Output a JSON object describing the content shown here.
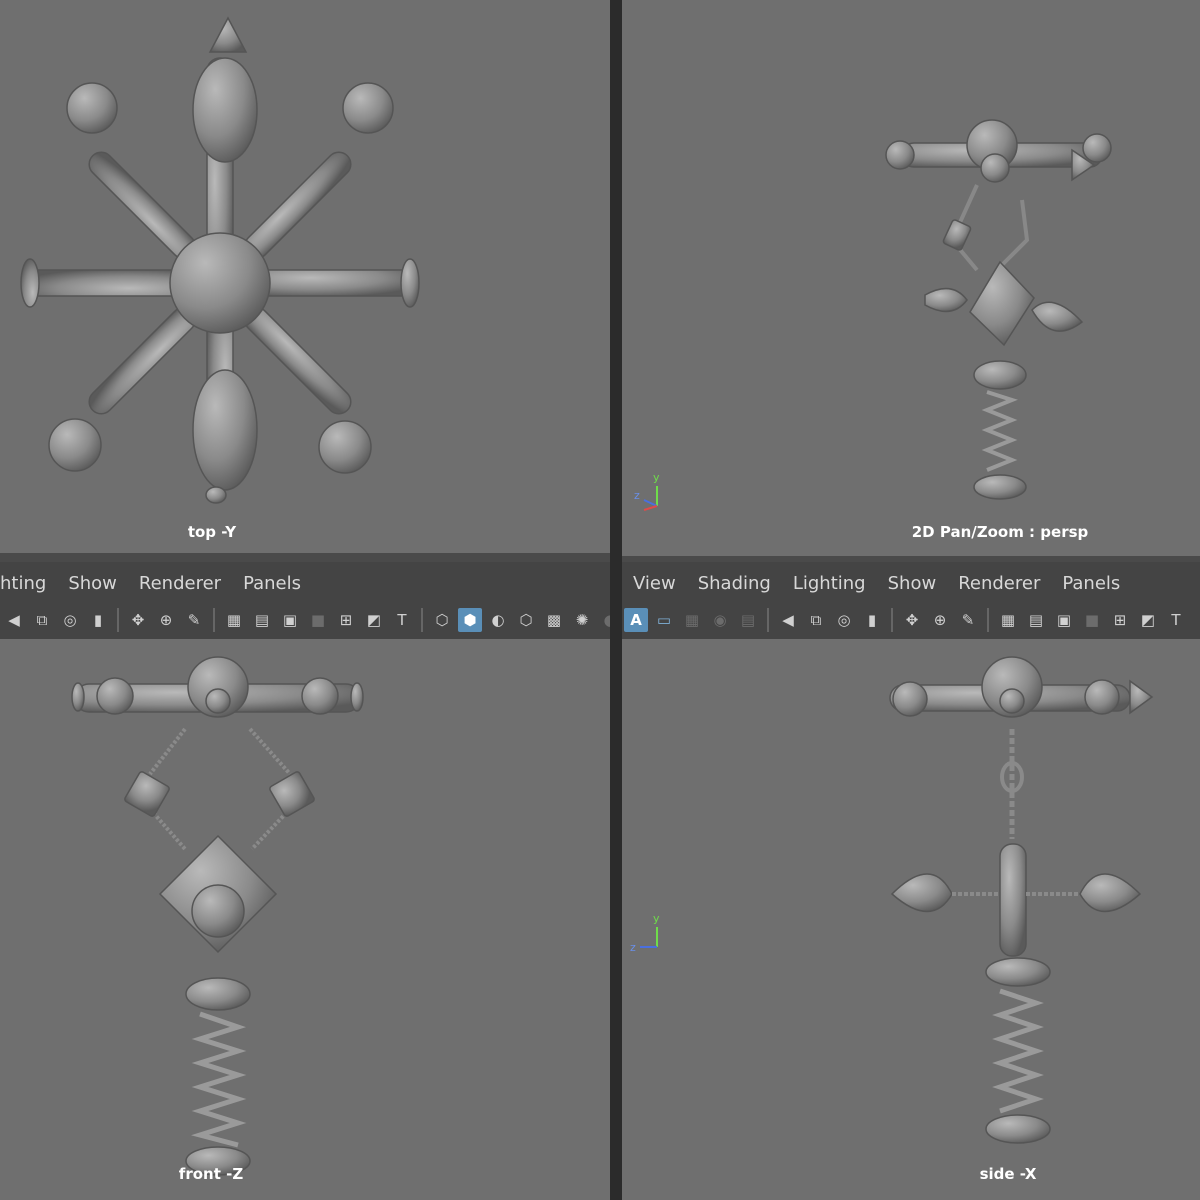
{
  "viewports": {
    "top": {
      "label": "top -Y"
    },
    "persp": {
      "label": "2D Pan/Zoom : persp",
      "axis": {
        "y": "y",
        "z": "z"
      }
    },
    "front": {
      "label": "front -Z"
    },
    "side": {
      "label": "side -X",
      "axis": {
        "y": "y",
        "z": "z"
      }
    }
  },
  "left_panel": {
    "menu": [
      "hting",
      "Show",
      "Renderer",
      "Panels"
    ],
    "toolbar_icons": [
      "camera-icon",
      "camera-attributes-icon",
      "bookmark-icon",
      "image-plane-icon",
      "move-icon",
      "paint-icon",
      "grid-icon",
      "film-gate-icon",
      "resolution-gate-icon",
      "gate-mask-icon",
      "field-chart-icon",
      "safe-action-icon",
      "safe-title-icon",
      "wireframe-icon",
      "smooth-shade-icon",
      "flat-lighting-icon",
      "xray-icon",
      "texture-icon",
      "lights-icon"
    ]
  },
  "right_panel": {
    "menu": [
      "View",
      "Shading",
      "Lighting",
      "Show",
      "Renderer",
      "Panels"
    ],
    "toolbar_icons": [
      "isolate-select-icon",
      "panel-layout-icon",
      "camera-icon",
      "camera-attributes-icon",
      "bookmark-icon",
      "image-plane-icon",
      "move-icon",
      "paint-icon",
      "grid-icon",
      "film-gate-icon",
      "resolution-gate-icon",
      "field-chart-icon",
      "safe-action-icon",
      "safe-title-icon"
    ],
    "active_letter": "A"
  },
  "colors": {
    "viewport_bg": "#6f6f6f",
    "panel_bg": "#444444",
    "accent": "#5a8fb8",
    "label": "#ffffff"
  }
}
